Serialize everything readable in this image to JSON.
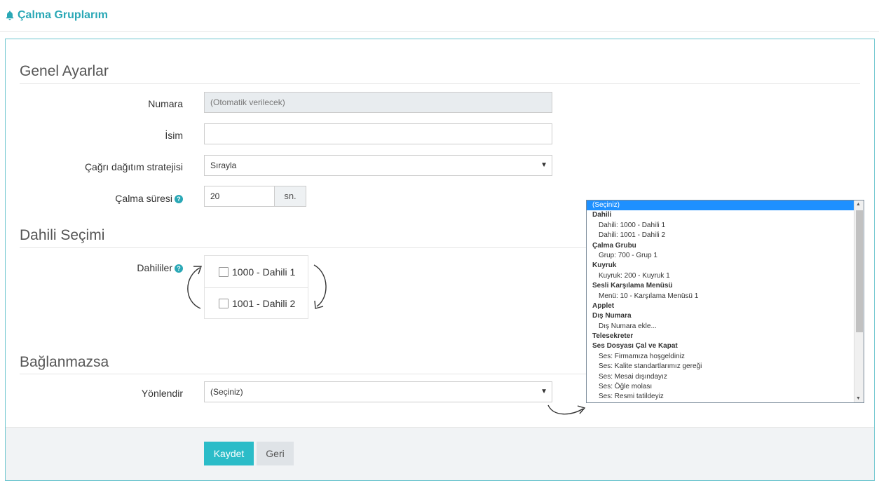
{
  "header": {
    "title": "Çalma Gruplarım"
  },
  "sections": {
    "general": "Genel Ayarlar",
    "extensions": "Dahili Seçimi",
    "no_answer": "Bağlanmazsa"
  },
  "fields": {
    "number": {
      "label": "Numara",
      "placeholder": "(Otomatik verilecek)"
    },
    "name": {
      "label": "İsim",
      "value": ""
    },
    "strategy": {
      "label": "Çağrı dağıtım stratejisi",
      "value": "Sırayla"
    },
    "ring_time": {
      "label": "Çalma süresi",
      "value": "20",
      "unit": "sn."
    },
    "extensions": {
      "label": "Dahililer",
      "options": [
        "1000 - Dahili 1",
        "1001 - Dahili 2"
      ]
    },
    "redirect": {
      "label": "Yönlendir",
      "value": "(Seçiniz)"
    }
  },
  "buttons": {
    "save": "Kaydet",
    "back": "Geri"
  },
  "dropdown": {
    "items": [
      {
        "text": "(Seçiniz)",
        "kind": "selected"
      },
      {
        "text": "Dahili",
        "kind": "group"
      },
      {
        "text": "Dahili: 1000 - Dahili 1",
        "kind": "option"
      },
      {
        "text": "Dahili: 1001 - Dahili 2",
        "kind": "option"
      },
      {
        "text": "Çalma Grubu",
        "kind": "group"
      },
      {
        "text": "Grup: 700 - Grup 1",
        "kind": "option"
      },
      {
        "text": "Kuyruk",
        "kind": "group"
      },
      {
        "text": "Kuyruk: 200 - Kuyruk 1",
        "kind": "option"
      },
      {
        "text": "Sesli Karşılama Menüsü",
        "kind": "group"
      },
      {
        "text": "Menü: 10 - Karşılama Menüsü 1",
        "kind": "option"
      },
      {
        "text": "Applet",
        "kind": "group"
      },
      {
        "text": "Dış Numara",
        "kind": "group"
      },
      {
        "text": "Dış Numara ekle...",
        "kind": "option"
      },
      {
        "text": "Telesekreter",
        "kind": "group"
      },
      {
        "text": "Ses Dosyası Çal ve Kapat",
        "kind": "group"
      },
      {
        "text": "Ses: Firmamıza hoşgeldiniz",
        "kind": "option"
      },
      {
        "text": "Ses: Kalite standartlarımız gereği",
        "kind": "option"
      },
      {
        "text": "Ses: Mesai dışındayız",
        "kind": "option"
      },
      {
        "text": "Ses: Öğle molası",
        "kind": "option"
      },
      {
        "text": "Ses: Resmi tatildeyiz",
        "kind": "option"
      }
    ]
  },
  "icons": {
    "header": "bell-icon",
    "help": "question-circle-icon",
    "select": "caret-down-icon"
  },
  "colors": {
    "accent": "#2aa8b6",
    "primary_button": "#2bbcc8",
    "selected_option": "#1e90ff"
  }
}
